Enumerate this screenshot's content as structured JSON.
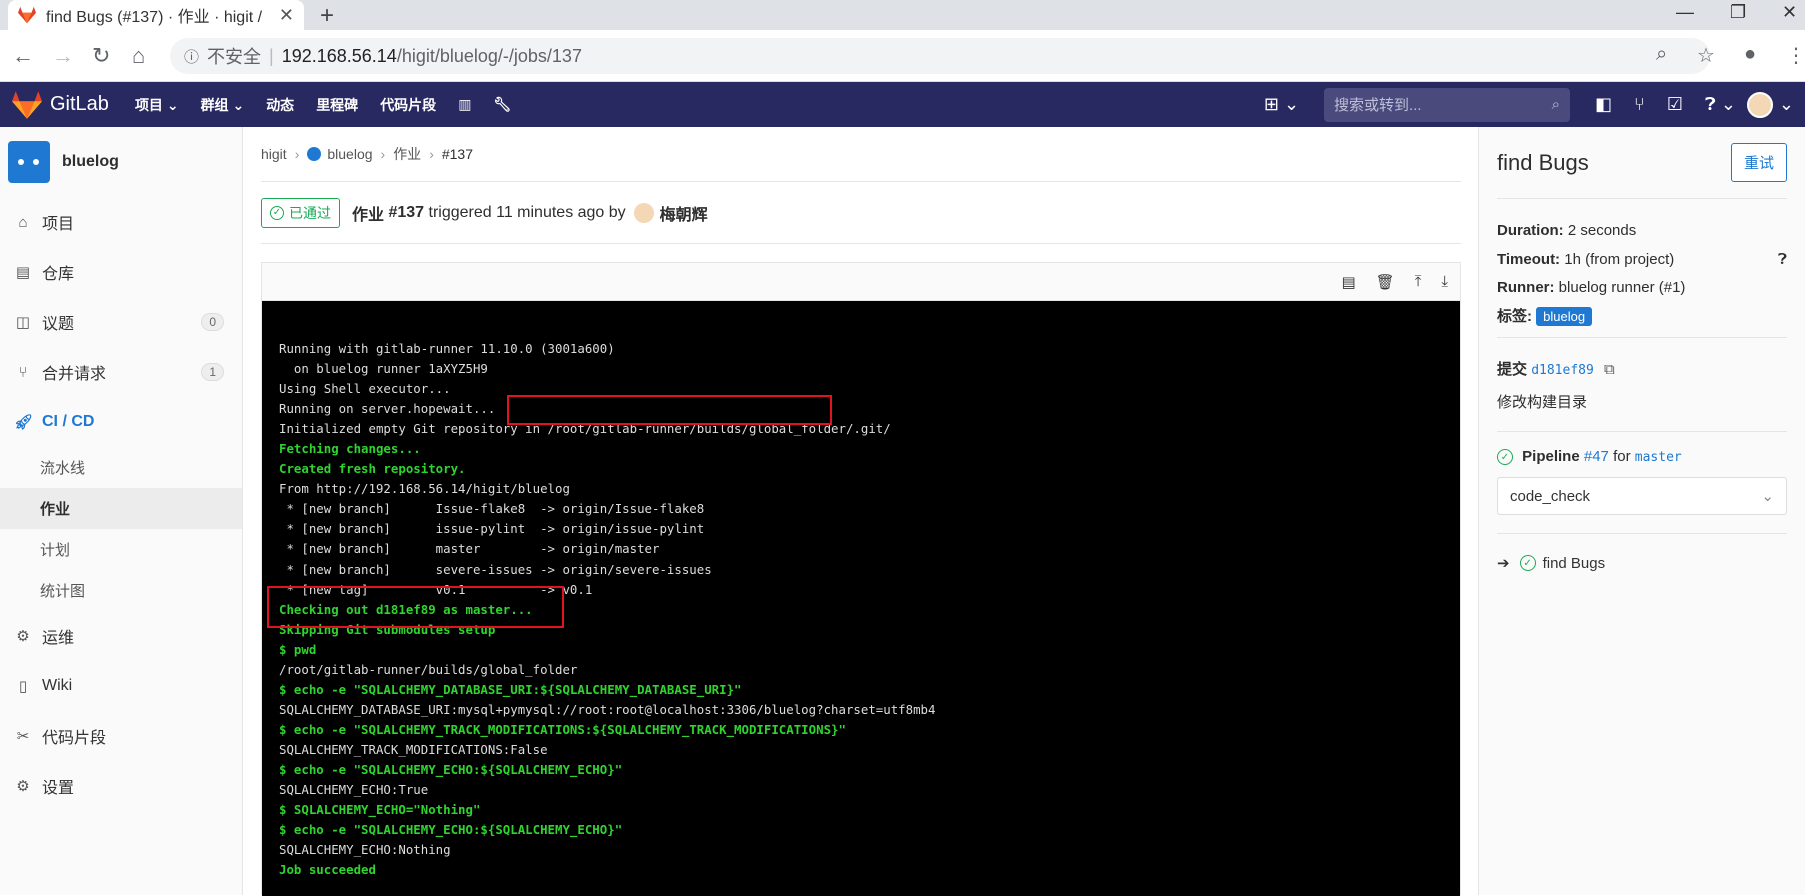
{
  "browser": {
    "tab_title": "find Bugs (#137) · 作业 · higit /",
    "insecure_label": "不安全",
    "url_host": "192.168.56.14",
    "url_path": "/higit/bluelog/-/jobs/137"
  },
  "header": {
    "brand": "GitLab",
    "nav": [
      "项目 ⌄",
      "群组 ⌄",
      "动态",
      "里程碑",
      "代码片段"
    ],
    "search_placeholder": "搜索或转到..."
  },
  "sidebar": {
    "project_name": "bluelog",
    "items": [
      {
        "label": "项目",
        "icon": "home-icon"
      },
      {
        "label": "仓库",
        "icon": "doc-icon"
      },
      {
        "label": "议题",
        "icon": "issues-icon",
        "badge": "0"
      },
      {
        "label": "合并请求",
        "icon": "merge-icon",
        "badge": "1"
      },
      {
        "label": "CI / CD",
        "icon": "rocket-icon"
      }
    ],
    "sub_items": [
      "流水线",
      "作业",
      "计划",
      "统计图"
    ],
    "bottom_items": [
      {
        "label": "运维",
        "icon": "ops-icon"
      },
      {
        "label": "Wiki",
        "icon": "book-icon"
      },
      {
        "label": "代码片段",
        "icon": "scissors-icon"
      },
      {
        "label": "设置",
        "icon": "gear-icon"
      }
    ]
  },
  "breadcrumb": [
    "higit",
    "bluelog",
    "作业",
    "#137"
  ],
  "job": {
    "status": "已通过",
    "title_prefix": "作业",
    "number": "#137",
    "triggered": "triggered 11 minutes ago by",
    "user": "梅朝辉"
  },
  "log_lines": [
    {
      "t": "Running with gitlab-runner 11.10.0 (3001a600)",
      "g": false
    },
    {
      "t": "  on bluelog runner 1aXYZ5H9",
      "g": false
    },
    {
      "t": "Using Shell executor...",
      "g": false
    },
    {
      "t": "Running on server.hopewait...",
      "g": false
    },
    {
      "t": "Initialized empty Git repository in /root/gitlab-runner/builds/global_folder/.git/",
      "g": false
    },
    {
      "t": "Fetching changes...",
      "g": true
    },
    {
      "t": "Created fresh repository.",
      "g": true
    },
    {
      "t": "From http://192.168.56.14/higit/bluelog",
      "g": false
    },
    {
      "t": " * [new branch]      Issue-flake8  -> origin/Issue-flake8",
      "g": false
    },
    {
      "t": " * [new branch]      issue-pylint  -> origin/issue-pylint",
      "g": false
    },
    {
      "t": " * [new branch]      master        -> origin/master",
      "g": false
    },
    {
      "t": " * [new branch]      severe-issues -> origin/severe-issues",
      "g": false
    },
    {
      "t": " * [new tag]         v0.1          -> v0.1",
      "g": false
    },
    {
      "t": "Checking out d181ef89 as master...",
      "g": true
    },
    {
      "t": "Skipping Git submodules setup",
      "g": true
    },
    {
      "t": "$ pwd",
      "g": true
    },
    {
      "t": "/root/gitlab-runner/builds/global_folder",
      "g": false
    },
    {
      "t": "$ echo -e \"SQLALCHEMY_DATABASE_URI:${SQLALCHEMY_DATABASE_URI}\"",
      "g": true
    },
    {
      "t": "SQLALCHEMY_DATABASE_URI:mysql+pymysql://root:root@localhost:3306/bluelog?charset=utf8mb4",
      "g": false
    },
    {
      "t": "$ echo -e \"SQLALCHEMY_TRACK_MODIFICATIONS:${SQLALCHEMY_TRACK_MODIFICATIONS}\"",
      "g": true
    },
    {
      "t": "SQLALCHEMY_TRACK_MODIFICATIONS:False",
      "g": false
    },
    {
      "t": "$ echo -e \"SQLALCHEMY_ECHO:${SQLALCHEMY_ECHO}\"",
      "g": true
    },
    {
      "t": "SQLALCHEMY_ECHO:True",
      "g": false
    },
    {
      "t": "$ SQLALCHEMY_ECHO=\"Nothing\"",
      "g": true
    },
    {
      "t": "$ echo -e \"SQLALCHEMY_ECHO:${SQLALCHEMY_ECHO}\"",
      "g": true
    },
    {
      "t": "SQLALCHEMY_ECHO:Nothing",
      "g": false
    },
    {
      "t": "Job succeeded",
      "g": true
    }
  ],
  "right": {
    "title": "find Bugs",
    "retry": "重试",
    "duration_label": "Duration:",
    "duration": "2 seconds",
    "timeout_label": "Timeout:",
    "timeout": "1h (from project)",
    "runner_label": "Runner:",
    "runner": "bluelog runner (#1)",
    "tags_label": "标签:",
    "tag": "bluelog",
    "commit_label": "提交",
    "commit_sha": "d181ef89",
    "commit_msg": "修改构建目录",
    "pipeline_label": "Pipeline",
    "pipeline_id": "#47",
    "for": "for",
    "branch": "master",
    "stage": "code_check",
    "job_name": "find Bugs"
  },
  "colors": {
    "header": "#292961",
    "accent": "#1f78d1",
    "success": "#1aaa55",
    "highlight": "#e0141e"
  }
}
